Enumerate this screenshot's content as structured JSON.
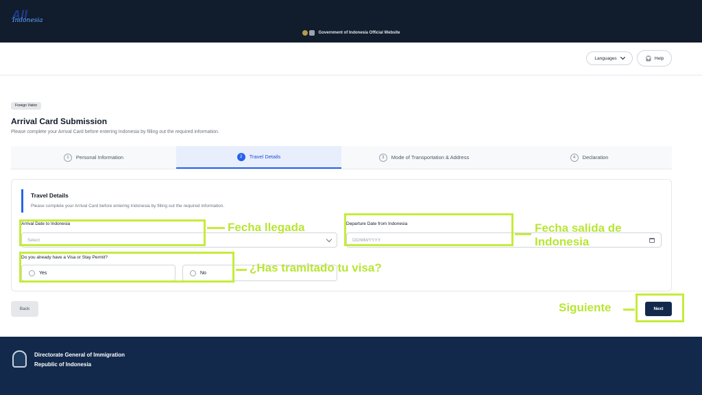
{
  "topbar": {
    "text": "Government of Indonesia Official Website"
  },
  "header": {
    "logo_main": "All",
    "logo_sub": "Indonesia",
    "languages_label": "Languages",
    "help_label": "Help"
  },
  "page": {
    "badge": "Foreign Visitor",
    "title": "Arrival Card Submission",
    "subtitle": "Please complete your Arrival Card before entering Indonesia by filling out the required information."
  },
  "steps": [
    {
      "num": "1",
      "label": "Personal Information"
    },
    {
      "num": "2",
      "label": "Travel Details"
    },
    {
      "num": "3",
      "label": "Mode of Transportation & Address"
    },
    {
      "num": "4",
      "label": "Declaration"
    }
  ],
  "form": {
    "section_title": "Travel Details",
    "section_sub": "Please complete your Arrival Card before entering Indonesia by filling out the required information.",
    "arrival_label": "Arrival Date to Indonesia",
    "arrival_placeholder": "Select",
    "departure_label": "Departure Date from Indonesia",
    "departure_placeholder": "DD/MM/YYYY",
    "visa_question": "Do you already have a Visa or Stay Permit?",
    "visa_yes": "Yes",
    "visa_no": "No"
  },
  "buttons": {
    "back": "Back",
    "next": "Next"
  },
  "footer": {
    "line1": "Directorate General of Immigration",
    "line2": "Republic of Indonesia"
  },
  "annotations": {
    "arrival": "Fecha llegada",
    "departure_1": "Fecha salida de",
    "departure_2": "Indonesia",
    "visa": "¿Has tramitado tu visa?",
    "next": "Siguiente"
  },
  "colors": {
    "highlight": "#c4ec3a",
    "primary": "#13294b",
    "accent": "#2563eb"
  }
}
